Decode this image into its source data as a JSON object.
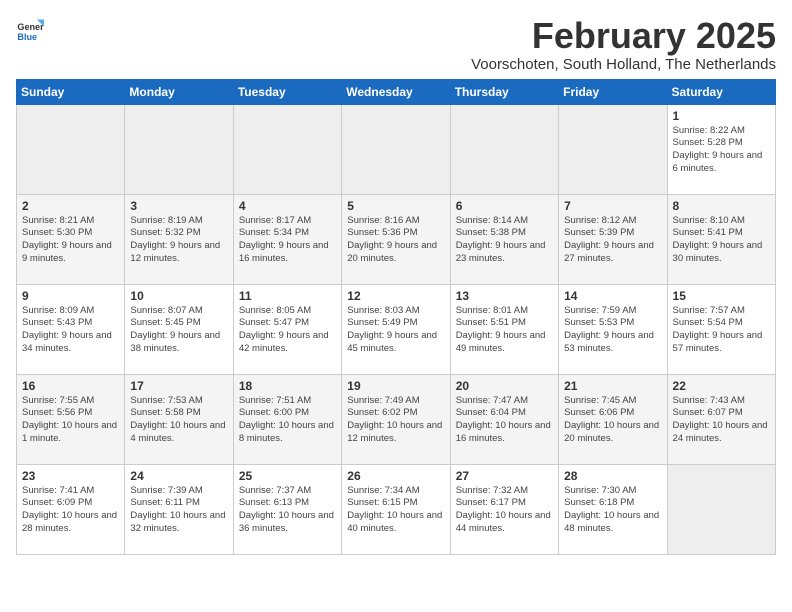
{
  "header": {
    "logo_general": "General",
    "logo_blue": "Blue",
    "title": "February 2025",
    "subtitle": "Voorschoten, South Holland, The Netherlands"
  },
  "columns": [
    "Sunday",
    "Monday",
    "Tuesday",
    "Wednesday",
    "Thursday",
    "Friday",
    "Saturday"
  ],
  "weeks": [
    [
      {
        "day": "",
        "info": ""
      },
      {
        "day": "",
        "info": ""
      },
      {
        "day": "",
        "info": ""
      },
      {
        "day": "",
        "info": ""
      },
      {
        "day": "",
        "info": ""
      },
      {
        "day": "",
        "info": ""
      },
      {
        "day": "1",
        "info": "Sunrise: 8:22 AM\nSunset: 5:28 PM\nDaylight: 9 hours and 6 minutes."
      }
    ],
    [
      {
        "day": "2",
        "info": "Sunrise: 8:21 AM\nSunset: 5:30 PM\nDaylight: 9 hours and 9 minutes."
      },
      {
        "day": "3",
        "info": "Sunrise: 8:19 AM\nSunset: 5:32 PM\nDaylight: 9 hours and 12 minutes."
      },
      {
        "day": "4",
        "info": "Sunrise: 8:17 AM\nSunset: 5:34 PM\nDaylight: 9 hours and 16 minutes."
      },
      {
        "day": "5",
        "info": "Sunrise: 8:16 AM\nSunset: 5:36 PM\nDaylight: 9 hours and 20 minutes."
      },
      {
        "day": "6",
        "info": "Sunrise: 8:14 AM\nSunset: 5:38 PM\nDaylight: 9 hours and 23 minutes."
      },
      {
        "day": "7",
        "info": "Sunrise: 8:12 AM\nSunset: 5:39 PM\nDaylight: 9 hours and 27 minutes."
      },
      {
        "day": "8",
        "info": "Sunrise: 8:10 AM\nSunset: 5:41 PM\nDaylight: 9 hours and 30 minutes."
      }
    ],
    [
      {
        "day": "9",
        "info": "Sunrise: 8:09 AM\nSunset: 5:43 PM\nDaylight: 9 hours and 34 minutes."
      },
      {
        "day": "10",
        "info": "Sunrise: 8:07 AM\nSunset: 5:45 PM\nDaylight: 9 hours and 38 minutes."
      },
      {
        "day": "11",
        "info": "Sunrise: 8:05 AM\nSunset: 5:47 PM\nDaylight: 9 hours and 42 minutes."
      },
      {
        "day": "12",
        "info": "Sunrise: 8:03 AM\nSunset: 5:49 PM\nDaylight: 9 hours and 45 minutes."
      },
      {
        "day": "13",
        "info": "Sunrise: 8:01 AM\nSunset: 5:51 PM\nDaylight: 9 hours and 49 minutes."
      },
      {
        "day": "14",
        "info": "Sunrise: 7:59 AM\nSunset: 5:53 PM\nDaylight: 9 hours and 53 minutes."
      },
      {
        "day": "15",
        "info": "Sunrise: 7:57 AM\nSunset: 5:54 PM\nDaylight: 9 hours and 57 minutes."
      }
    ],
    [
      {
        "day": "16",
        "info": "Sunrise: 7:55 AM\nSunset: 5:56 PM\nDaylight: 10 hours and 1 minute."
      },
      {
        "day": "17",
        "info": "Sunrise: 7:53 AM\nSunset: 5:58 PM\nDaylight: 10 hours and 4 minutes."
      },
      {
        "day": "18",
        "info": "Sunrise: 7:51 AM\nSunset: 6:00 PM\nDaylight: 10 hours and 8 minutes."
      },
      {
        "day": "19",
        "info": "Sunrise: 7:49 AM\nSunset: 6:02 PM\nDaylight: 10 hours and 12 minutes."
      },
      {
        "day": "20",
        "info": "Sunrise: 7:47 AM\nSunset: 6:04 PM\nDaylight: 10 hours and 16 minutes."
      },
      {
        "day": "21",
        "info": "Sunrise: 7:45 AM\nSunset: 6:06 PM\nDaylight: 10 hours and 20 minutes."
      },
      {
        "day": "22",
        "info": "Sunrise: 7:43 AM\nSunset: 6:07 PM\nDaylight: 10 hours and 24 minutes."
      }
    ],
    [
      {
        "day": "23",
        "info": "Sunrise: 7:41 AM\nSunset: 6:09 PM\nDaylight: 10 hours and 28 minutes."
      },
      {
        "day": "24",
        "info": "Sunrise: 7:39 AM\nSunset: 6:11 PM\nDaylight: 10 hours and 32 minutes."
      },
      {
        "day": "25",
        "info": "Sunrise: 7:37 AM\nSunset: 6:13 PM\nDaylight: 10 hours and 36 minutes."
      },
      {
        "day": "26",
        "info": "Sunrise: 7:34 AM\nSunset: 6:15 PM\nDaylight: 10 hours and 40 minutes."
      },
      {
        "day": "27",
        "info": "Sunrise: 7:32 AM\nSunset: 6:17 PM\nDaylight: 10 hours and 44 minutes."
      },
      {
        "day": "28",
        "info": "Sunrise: 7:30 AM\nSunset: 6:18 PM\nDaylight: 10 hours and 48 minutes."
      },
      {
        "day": "",
        "info": ""
      }
    ]
  ]
}
